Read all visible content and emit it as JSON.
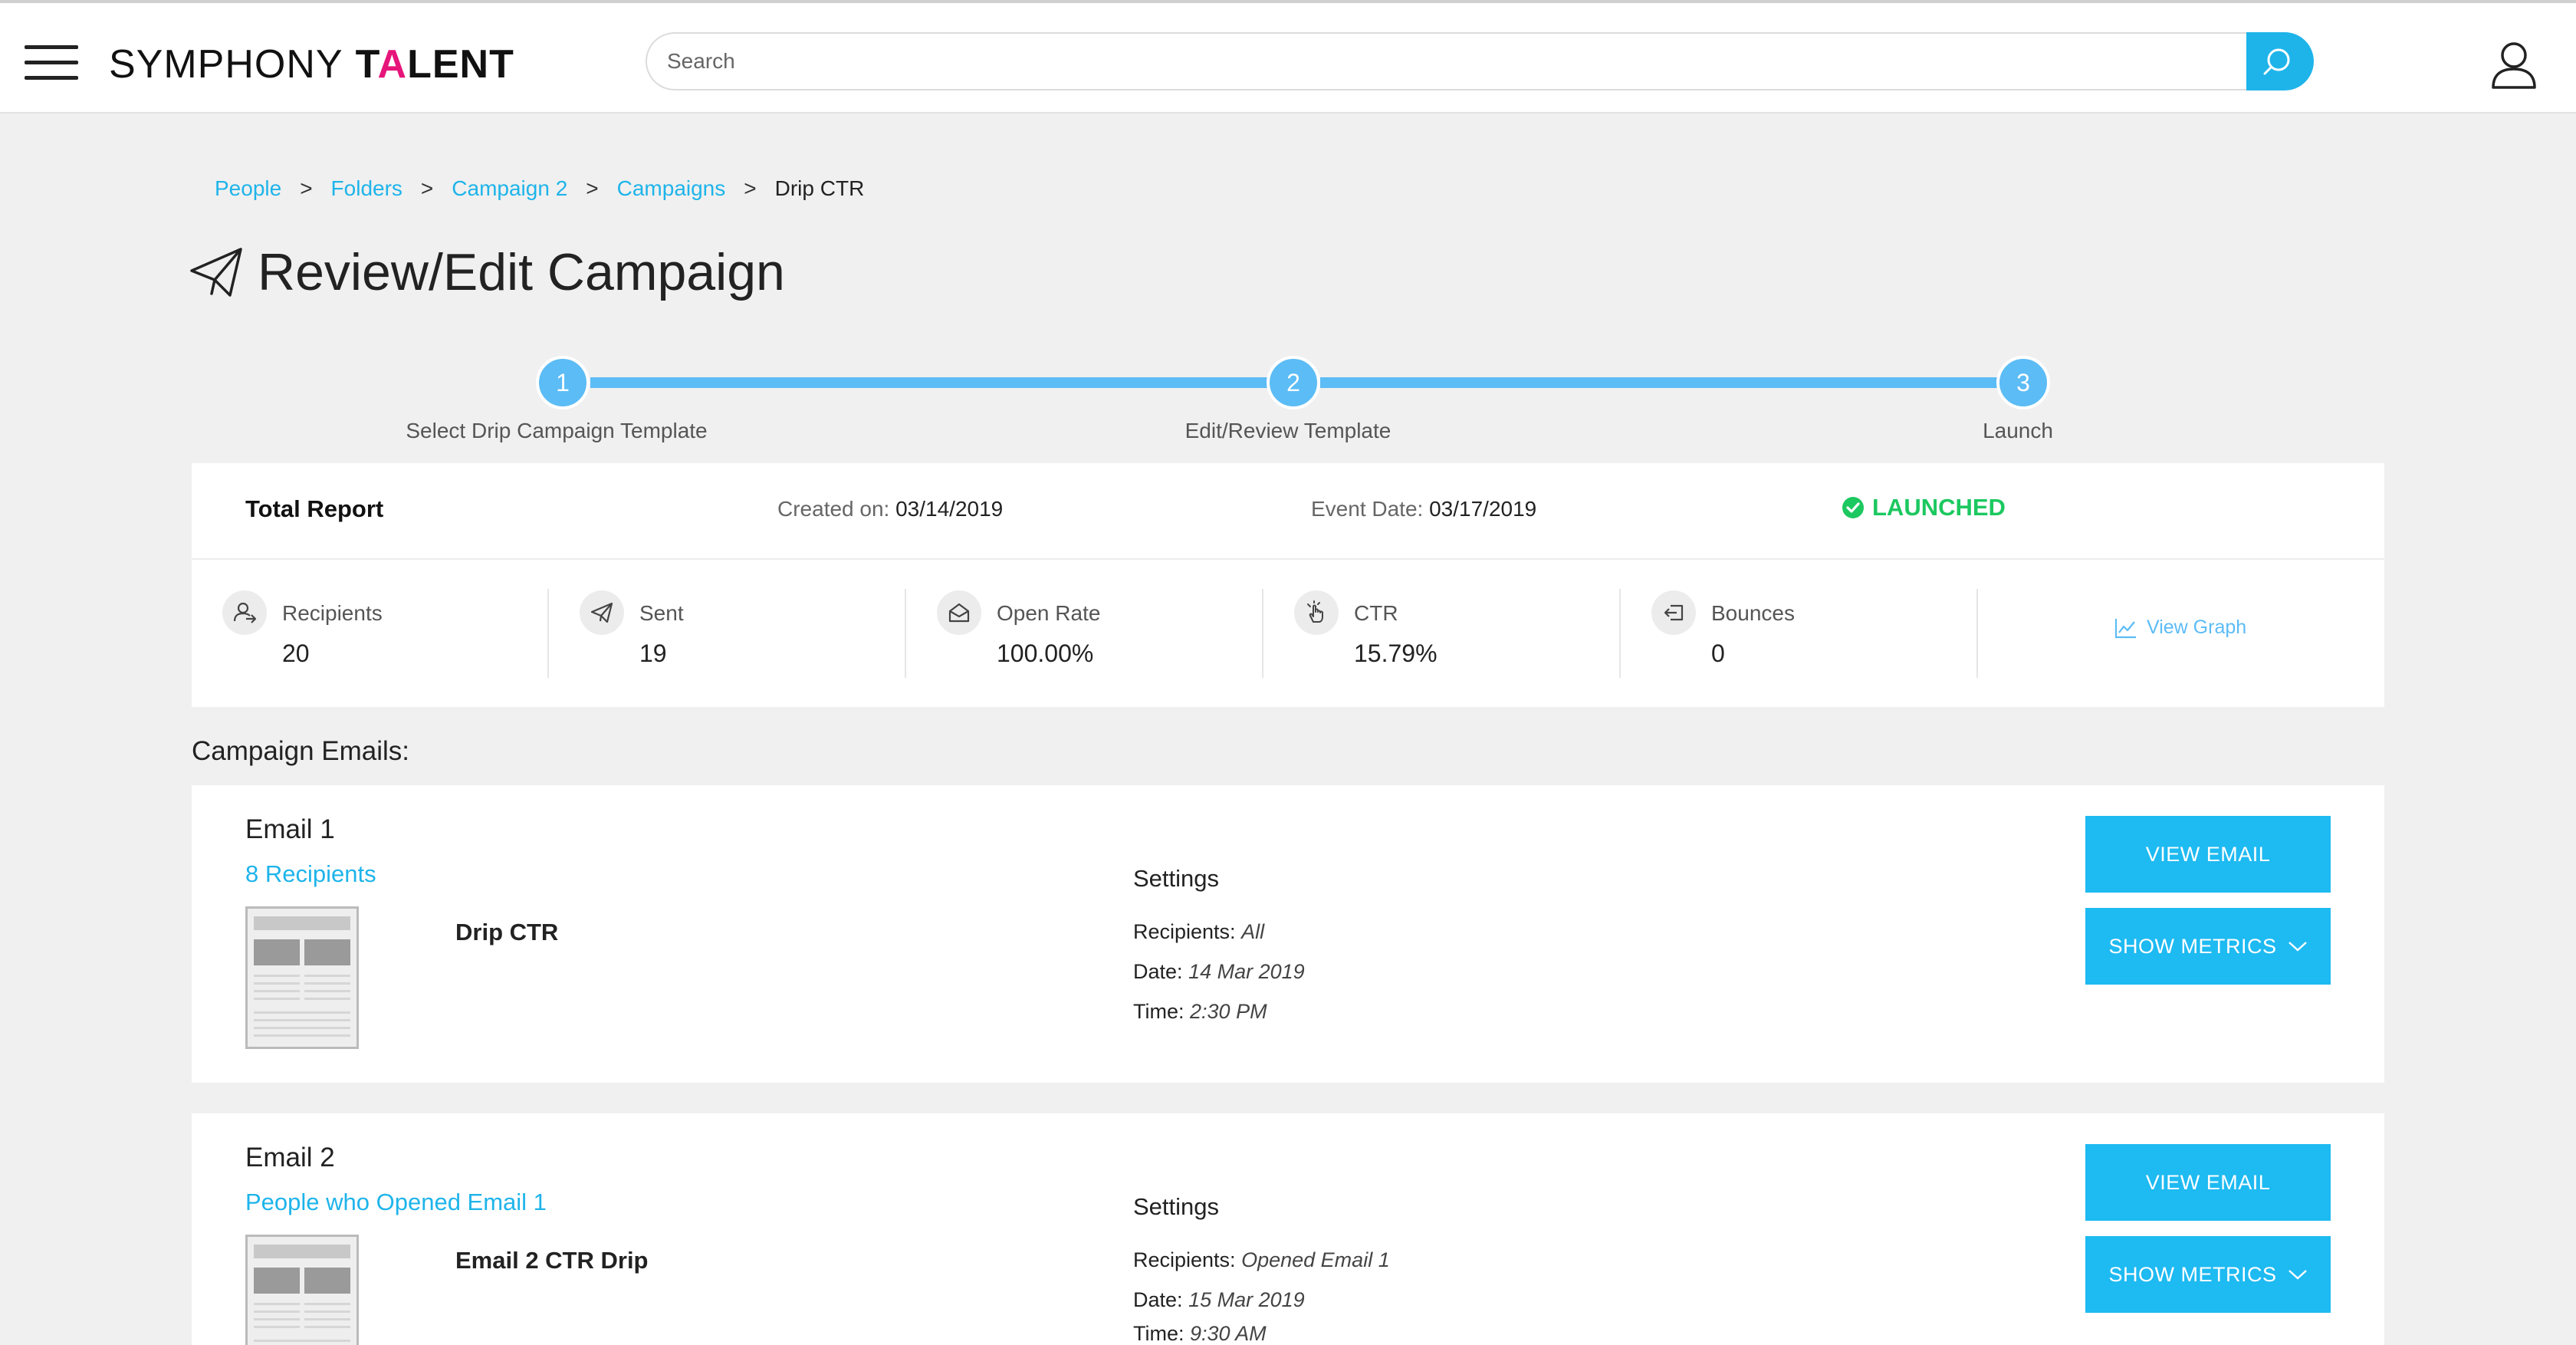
{
  "header": {
    "logo_light": "SYMPHONY",
    "logo_bold_pre": "T",
    "logo_bold_accent": "A",
    "logo_bold_post": "LENT",
    "search_placeholder": "Search"
  },
  "breadcrumb": {
    "items": [
      "People",
      "Folders",
      "Campaign 2",
      "Campaigns"
    ],
    "separator": ">",
    "current": "Drip CTR"
  },
  "page_title": "Review/Edit Campaign",
  "stepper": {
    "steps": [
      {
        "number": "1",
        "label": "Select Drip Campaign Template"
      },
      {
        "number": "2",
        "label": "Edit/Review Template"
      },
      {
        "number": "3",
        "label": "Launch"
      }
    ]
  },
  "report": {
    "title": "Total Report",
    "created_label": "Created on:",
    "created_value": "03/14/2019",
    "event_label": "Event Date:",
    "event_value": "03/17/2019",
    "status": "LAUNCHED",
    "status_color": "#1cc860",
    "metrics": [
      {
        "label": "Recipients",
        "value": "20",
        "icon": "recipients-icon"
      },
      {
        "label": "Sent",
        "value": "19",
        "icon": "paper-plane-icon"
      },
      {
        "label": "Open Rate",
        "value": "100.00%",
        "icon": "envelope-open-icon"
      },
      {
        "label": "CTR",
        "value": "15.79%",
        "icon": "hand-click-icon"
      },
      {
        "label": "Bounces",
        "value": "0",
        "icon": "bounce-icon"
      }
    ],
    "view_graph": "View Graph"
  },
  "section_title": "Campaign Emails:",
  "emails": [
    {
      "name": "Email 1",
      "recipients_link": "8 Recipients",
      "subject": "Drip CTR",
      "settings_title": "Settings",
      "recipients_label": "Recipients:",
      "recipients_value": "All",
      "date_label": "Date:",
      "date_value": "14 Mar 2019",
      "time_label": "Time:",
      "time_value": "2:30 PM",
      "view_button": "VIEW EMAIL",
      "metrics_button": "SHOW METRICS"
    },
    {
      "name": "Email 2",
      "recipients_link": "People who Opened Email 1",
      "subject": "Email 2 CTR Drip",
      "settings_title": "Settings",
      "recipients_label": "Recipients:",
      "recipients_value": "Opened Email 1",
      "date_label": "Date:",
      "date_value": "15 Mar 2019",
      "time_label": "Time:",
      "time_value": "9:30 AM",
      "view_button": "VIEW EMAIL",
      "metrics_button": "SHOW METRICS"
    }
  ],
  "colors": {
    "accent": "#1eb4ea",
    "stepper": "#5cbcf5",
    "brand_pink": "#e6157a",
    "background": "#f0f0f0"
  }
}
